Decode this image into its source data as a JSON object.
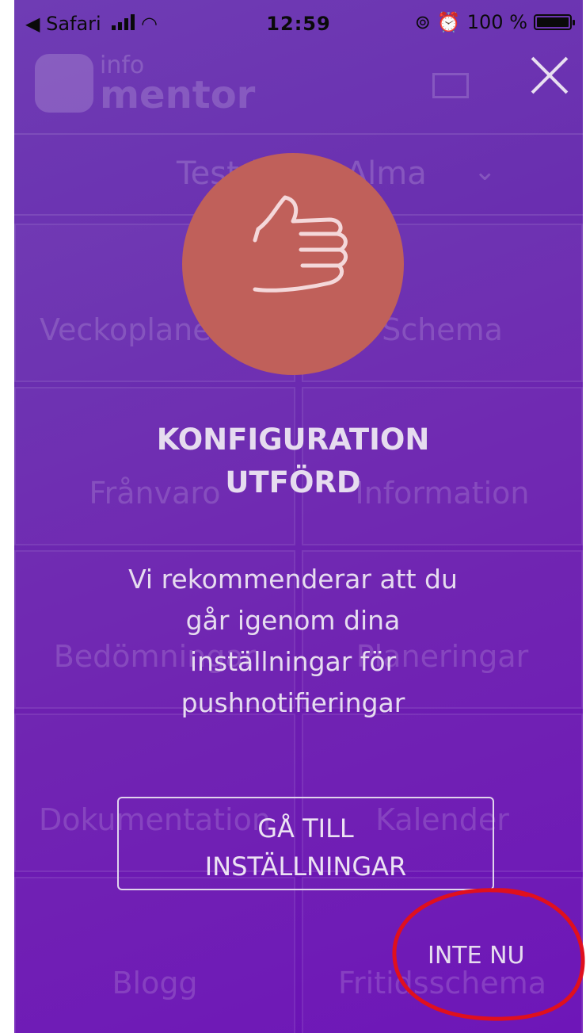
{
  "status_bar": {
    "back_label": "◀ Safari",
    "time": "12:59",
    "battery_text": "100 %"
  },
  "background_app": {
    "logo_small": "info",
    "logo_big": "mentor",
    "student_name": "Testdotter Alma",
    "tiles": [
      "Veckoplanering",
      "Schema",
      "Frånvaro",
      "Information",
      "Bedömningar",
      "Planeringar",
      "Dokumentation",
      "Kalender",
      "Blogg",
      "Fritidsschema"
    ]
  },
  "modal": {
    "title_line1": "KONFIGURATION",
    "title_line2": "UTFÖRD",
    "message_lines": [
      "Vi rekommenderar att du",
      "går igenom dina",
      "inställningar för",
      "pushnotifieringar"
    ],
    "settings_button_line1": "GÅ TILL",
    "settings_button_line2": "INSTÄLLNINGAR",
    "dismiss_label": "INTE NU",
    "hero_icon": "thumbs-up-icon",
    "close_icon": "close-icon"
  },
  "colors": {
    "hero_circle": "#c0605a",
    "annotation": "#e0101e",
    "text": "#e6dcef"
  }
}
